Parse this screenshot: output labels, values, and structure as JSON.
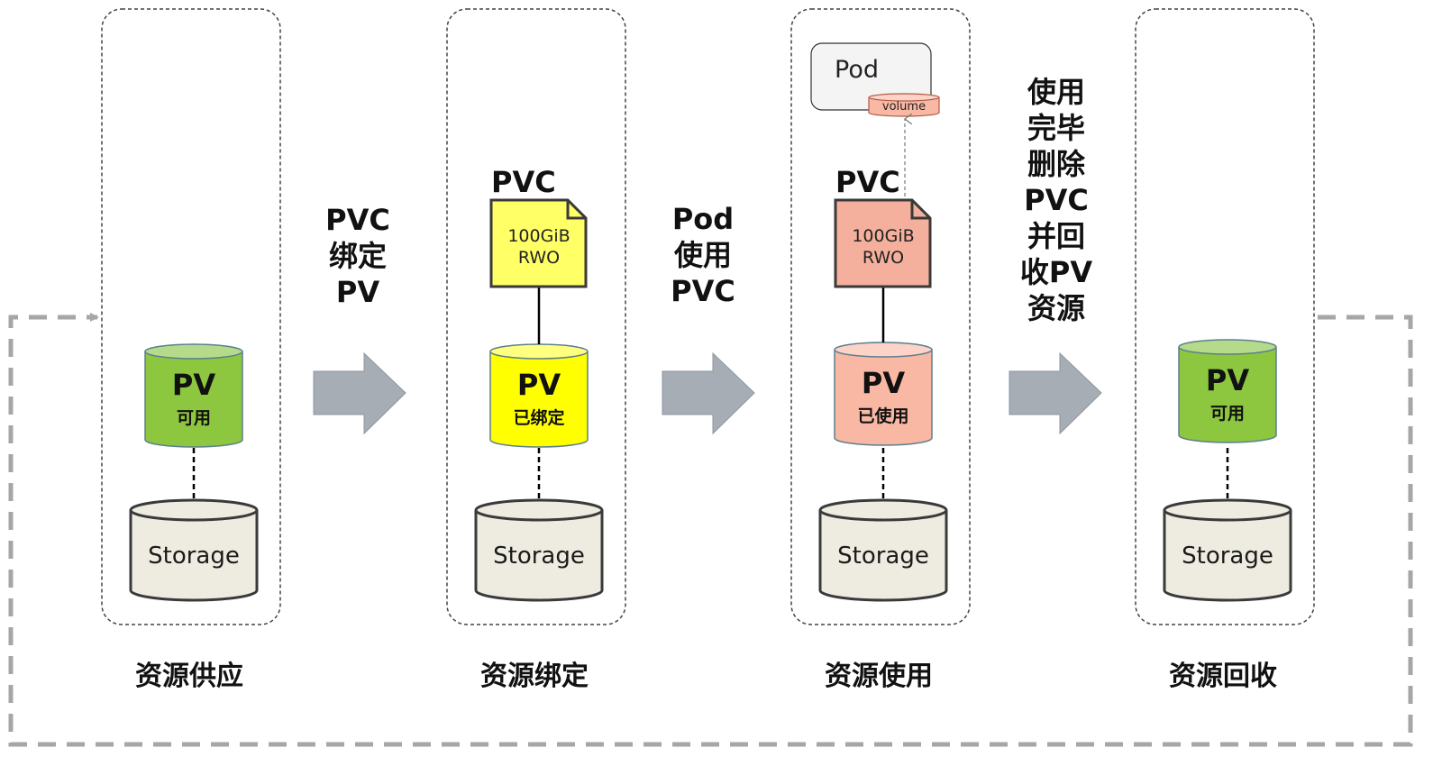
{
  "stages": [
    {
      "title": "资源供应",
      "pv": {
        "label": "PV",
        "status": "可用"
      },
      "storage": "Storage",
      "pvc": null
    },
    {
      "title": "资源绑定",
      "pv": {
        "label": "PV",
        "status": "已绑定"
      },
      "storage": "Storage",
      "pvc": {
        "label": "PVC",
        "line1": "100GiB",
        "line2": "RWO"
      }
    },
    {
      "title": "资源使用",
      "pv": {
        "label": "PV",
        "status": "已使用"
      },
      "storage": "Storage",
      "pvc": {
        "label": "PVC",
        "line1": "100GiB",
        "line2": "RWO"
      },
      "pod": {
        "label": "Pod",
        "volume": "volume"
      }
    },
    {
      "title": "资源回收",
      "pv": {
        "label": "PV",
        "status": "可用"
      },
      "storage": "Storage",
      "pvc": null
    }
  ],
  "transitions": [
    {
      "lines": [
        "PVC",
        "绑定",
        "PV"
      ]
    },
    {
      "lines": [
        "Pod",
        "使用",
        "PVC"
      ]
    },
    {
      "lines": [
        "使用",
        "完毕",
        "删除",
        "PVC",
        "并回",
        "收PV",
        "资源"
      ]
    }
  ],
  "colors": {
    "pv_available": "#8DC63F",
    "pv_available_top": "#B5DB8A",
    "pv_bound": "#FFFF00",
    "pv_bound_top": "#FFFF80",
    "pv_used": "#F9B8A4",
    "pv_used_top": "#FCD3C6",
    "pvc_bound": "#FFFF66",
    "pvc_used": "#F4B09C",
    "storage": "#EEECE1",
    "arrow": "#A6ADB5",
    "loop": "#A6A6A6"
  }
}
